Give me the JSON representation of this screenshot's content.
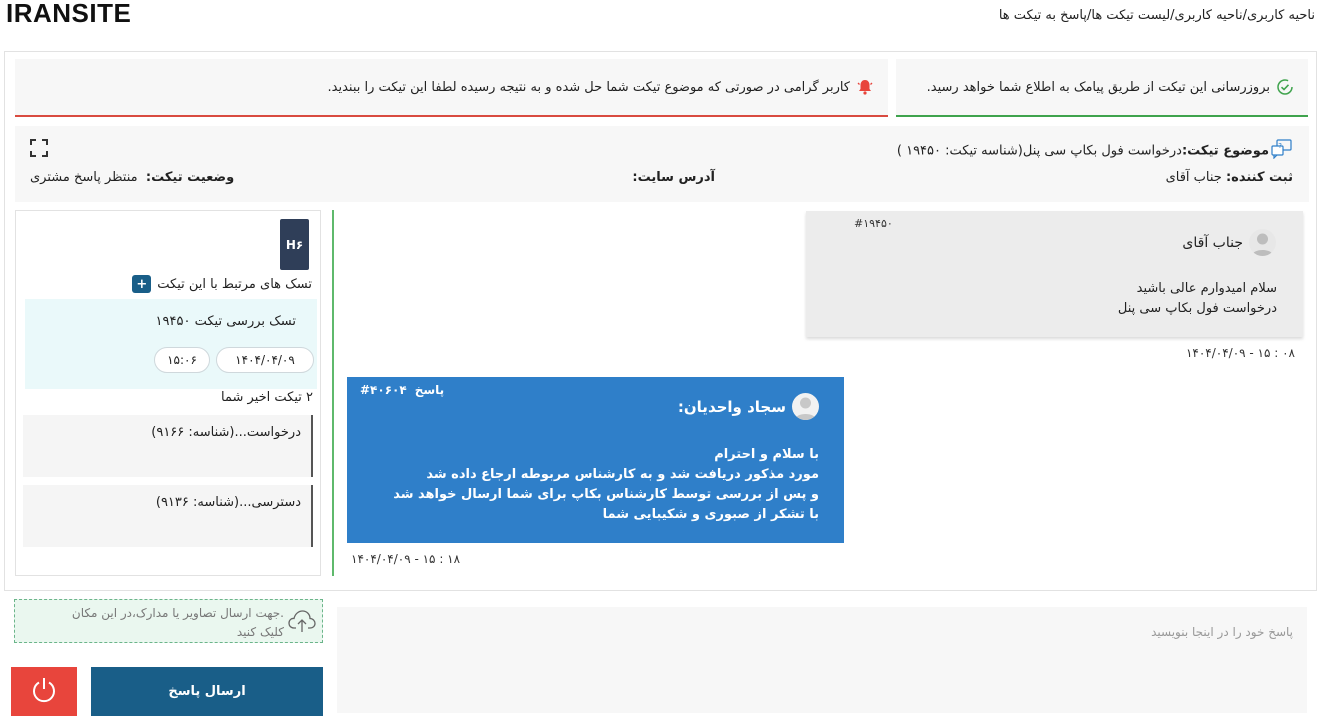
{
  "header": {
    "logo": "IRANSITE",
    "breadcrumb": "ناحیه کاربری/ناحیه کاربری/لیست تیکت ها/پاسخ به تیکت ها"
  },
  "alerts": {
    "sms": "بروزرسانی این تیکت از طریق پیامک به اطلاع شما خواهد رسید.",
    "notice": "کاربر گرامی در صورتی که موضوع تیکت شما حل شده و به نتیجه رسیده لطفا این تیکت را ببندید."
  },
  "ticket": {
    "subject_label": "موضوع تیکت:",
    "subject_value": "درخواست فول بکاپ سی پنل(شناسه تیکت: ۱۹۴۵۰ )",
    "creator_label": "ثبت کننده:",
    "creator_value": "جناب آقای",
    "site_label": "آدرس سایت:",
    "status_label": "وضعیت تیکت:",
    "status_value": "منتظر پاسخ مشتری"
  },
  "sidebar": {
    "badge": "H۶",
    "tasks_title": "تسک های مرتبط با این تیکت",
    "plus_label": "+",
    "task": {
      "title": "تسک بررسی تیکت ۱۹۴۵۰",
      "date": "۱۴۰۴/۰۴/۰۹",
      "time": "۱۵:۰۶"
    },
    "recent_title": "۲ تیکت اخیر شما",
    "recent": [
      {
        "text": "درخواست...(شناسه: ۹۱۶۶)"
      },
      {
        "text": "دسترسی...(شناسه: ۹۱۳۶)"
      }
    ]
  },
  "messages": [
    {
      "author": "جناب آقای",
      "id": "#۱۹۴۵۰",
      "lines": [
        "سلام امیدوارم عالی باشید",
        "درخواست فول بکاپ سی پنل"
      ],
      "timestamp": "۱۴۰۴/۰۴/۰۹ - ۱۵ : ۰۸"
    },
    {
      "author": "سجاد واحدیان:",
      "id": "#۴۰۶۰۴",
      "tag": "پاسخ",
      "lines": [
        "با سلام و احترام",
        "مورد مذکور دریافت شد و به کارشناس مربوطه ارجاع داده شد",
        "و پس از بررسی توسط کارشناس بکاپ برای شما ارسال خواهد شد",
        "با تشکر از صبوری و شکیبایی  شما"
      ],
      "timestamp": "۱۴۰۴/۰۴/۰۹ - ۱۵ : ۱۸"
    }
  ],
  "compose": {
    "upload_text": ".جهت ارسال تصاویر یا مدارک،در این مکان کلیک کنید",
    "placeholder": "پاسخ خود را در اینجا بنویسید",
    "send_label": "ارسال پاسخ"
  },
  "colors": {
    "primary": "#195e88",
    "reply_bubble": "#2f7fc9",
    "success": "#3fa34d",
    "danger": "#e8453c",
    "badge": "#2f3e58"
  }
}
